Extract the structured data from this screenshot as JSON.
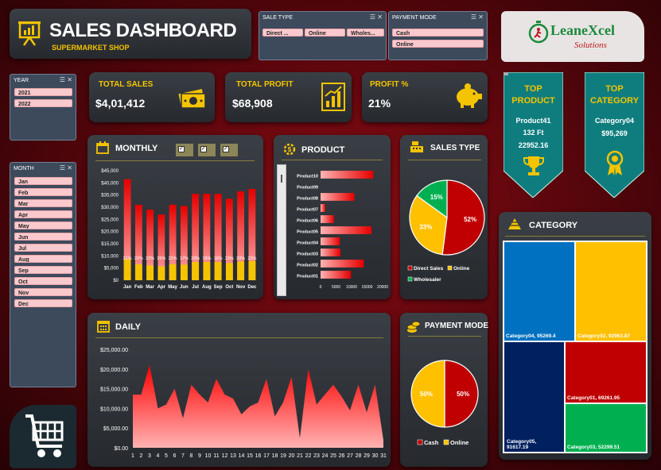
{
  "header": {
    "title": "SALES DASHBOARD",
    "subtitle": "SUPERMARKET SHOP"
  },
  "filters": {
    "sale_type": {
      "label": "SALE TYPE",
      "options": [
        "Direct ...",
        "Online",
        "Wholes..."
      ]
    },
    "payment_mode": {
      "label": "PAYMENT MODE",
      "options": [
        "Cash",
        "Online"
      ]
    },
    "year": {
      "label": "YEAR",
      "options": [
        "2021",
        "2022"
      ]
    },
    "month": {
      "label": "MONTH",
      "options": [
        "Jan",
        "Feb",
        "Mar",
        "Apr",
        "May",
        "Jun",
        "Jul",
        "Aug",
        "Sep",
        "Oct",
        "Nov",
        "Dec"
      ]
    }
  },
  "logo": {
    "brand": "LeaneXcel",
    "tagline": "Solutions"
  },
  "kpis": {
    "total_sales_label": "TOTAL SALES",
    "total_sales": "$4,01,412",
    "total_profit_label": "TOTAL PROFIT",
    "total_profit": "$68,908",
    "profit_pct_label": "PROFIT %",
    "profit_pct": "21%"
  },
  "top_product": {
    "title1": "TOP",
    "title2": "PRODUCT",
    "name": "Product41",
    "qty": "132 Ft",
    "value": "22952.16"
  },
  "top_category": {
    "title1": "TOP",
    "title2": "CATEGORY",
    "name": "Category04",
    "value": "$95,269"
  },
  "sections": {
    "monthly": "MONTHLY",
    "product": "PRODUCT",
    "sales_type": "SALES TYPE",
    "category": "CATEGORY",
    "daily": "DAILY",
    "payment_mode": "PAYMENT MODE"
  },
  "colors": {
    "gold": "#f5c400",
    "red": "#e30613",
    "green": "#00a651",
    "blue": "#0070c0",
    "navy": "#002060",
    "teal": "#0f7d7e"
  },
  "chart_data": [
    {
      "id": "monthly",
      "type": "bar",
      "categories": [
        "Jan",
        "Feb",
        "Mar",
        "Apr",
        "May",
        "Jun",
        "Jul",
        "Aug",
        "Sep",
        "Oct",
        "Nov",
        "Dec"
      ],
      "series": [
        {
          "values": [
            41500,
            31000,
            29000,
            27000,
            31000,
            30500,
            35500,
            35500,
            35500,
            33500,
            36500,
            37500
          ]
        }
      ],
      "data_labels": [
        "21%",
        "22%",
        "22%",
        "25%",
        "22%",
        "17%",
        "23%",
        "18%",
        "18%",
        "23%",
        "20%",
        "23%",
        "20%"
      ],
      "yticks": [
        "$0",
        "$5,000",
        "$10,000",
        "$15,000",
        "$20,000",
        "$25,000",
        "$30,000",
        "$35,000",
        "$40,000",
        "$45,000"
      ],
      "ylim": [
        0,
        45000
      ]
    },
    {
      "id": "product",
      "type": "bar",
      "orientation": "horizontal",
      "categories": [
        "Product10",
        "Product09",
        "Product08",
        "Product07",
        "Product06",
        "Product05",
        "Product04",
        "Product03",
        "Product02",
        "Product01"
      ],
      "values": [
        17000,
        0,
        10900,
        1500,
        4300,
        16400,
        6200,
        6400,
        13900,
        9800
      ],
      "xticks": [
        "0",
        "5000",
        "10000",
        "15000",
        "20000"
      ],
      "xlim": [
        0,
        20000
      ]
    },
    {
      "id": "sales_type",
      "type": "pie",
      "categories": [
        "Direct Sales",
        "Online",
        "Wholesaler"
      ],
      "values": [
        52,
        33,
        15
      ],
      "labels": [
        "52%",
        "33%",
        "15%"
      ]
    },
    {
      "id": "category",
      "type": "heatmap",
      "subtype": "treemap",
      "categories": [
        "Category04",
        "Category02",
        "Category05",
        "Category01",
        "Category03"
      ],
      "values": [
        95269.4,
        92963.87,
        91617.19,
        69261.95,
        52299.51
      ],
      "labels": [
        "Category04, 95269.4",
        "Category02, 92963.87",
        "Category05, 91617.19",
        "Category01, 69261.95",
        "Category03, 52299.51"
      ]
    },
    {
      "id": "daily",
      "type": "area",
      "x": [
        1,
        2,
        3,
        4,
        5,
        6,
        7,
        8,
        9,
        10,
        11,
        12,
        13,
        14,
        15,
        16,
        17,
        18,
        19,
        20,
        21,
        22,
        23,
        24,
        25,
        26,
        27,
        28,
        29,
        30,
        31
      ],
      "values": [
        13500,
        13500,
        21000,
        10000,
        11000,
        15000,
        7500,
        16000,
        13500,
        11500,
        17500,
        13500,
        12500,
        8500,
        10500,
        11500,
        17500,
        8000,
        11500,
        18000,
        2500,
        20000,
        11000,
        13500,
        16000,
        13000,
        9500,
        16000,
        9000,
        16000,
        2000
      ],
      "yticks": [
        "$0.00",
        "$5,000.00",
        "$10,000.00",
        "$15,000.00",
        "$20,000.00",
        "$25,000.00"
      ],
      "ylim": [
        0,
        25000
      ]
    },
    {
      "id": "payment_mode",
      "type": "pie",
      "categories": [
        "Cash",
        "Online"
      ],
      "values": [
        50,
        50
      ],
      "labels": [
        "50%",
        "50%"
      ]
    }
  ]
}
